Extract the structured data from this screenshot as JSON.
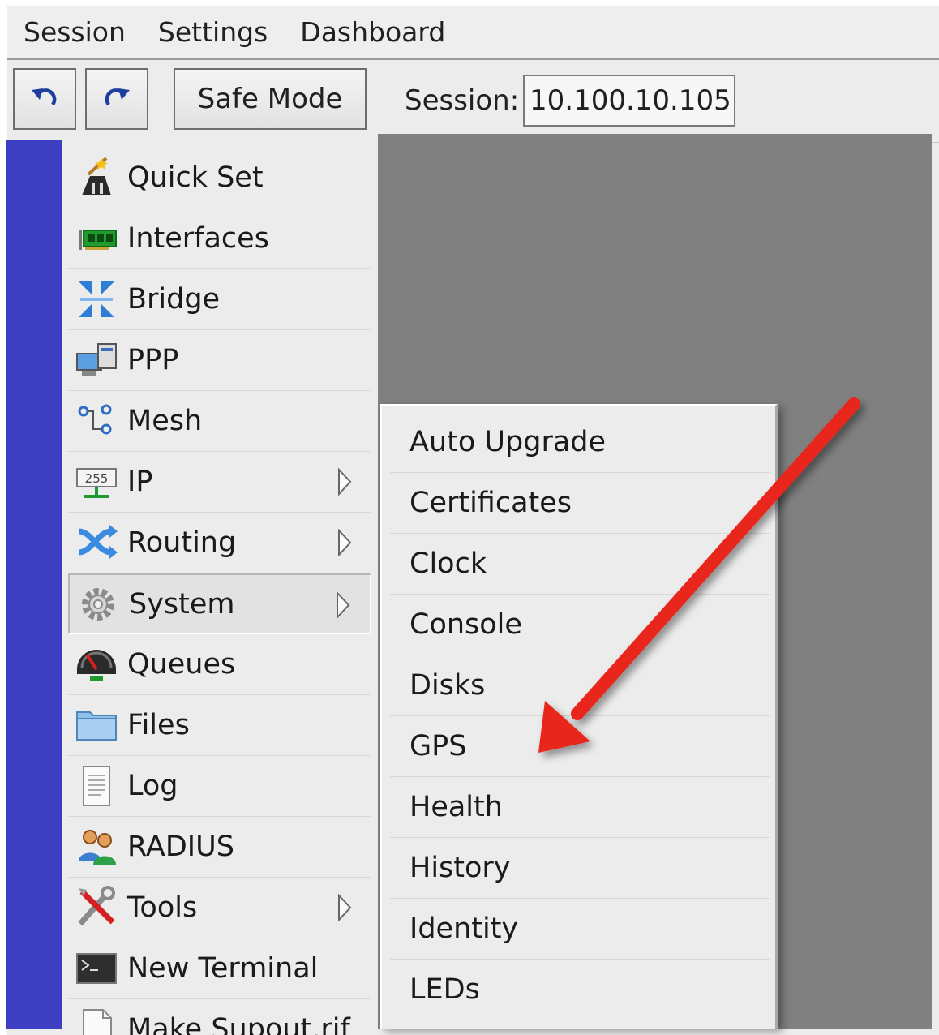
{
  "menubar": {
    "items": [
      "Session",
      "Settings",
      "Dashboard"
    ]
  },
  "toolbar": {
    "undo_icon": "undo-icon",
    "redo_icon": "redo-icon",
    "safe_mode_label": "Safe Mode",
    "session_label": "Session:",
    "session_value": "10.100.10.105"
  },
  "sidebar": {
    "items": [
      {
        "label": "Quick Set",
        "icon": "wand-icon",
        "submenu": false
      },
      {
        "label": "Interfaces",
        "icon": "network-card-icon",
        "submenu": false
      },
      {
        "label": "Bridge",
        "icon": "bridge-icon",
        "submenu": false
      },
      {
        "label": "PPP",
        "icon": "ppp-icon",
        "submenu": false
      },
      {
        "label": "Mesh",
        "icon": "mesh-icon",
        "submenu": false
      },
      {
        "label": "IP",
        "icon": "ip-icon",
        "submenu": true
      },
      {
        "label": "Routing",
        "icon": "routing-icon",
        "submenu": true
      },
      {
        "label": "System",
        "icon": "gear-icon",
        "submenu": true,
        "selected": true
      },
      {
        "label": "Queues",
        "icon": "gauge-icon",
        "submenu": false
      },
      {
        "label": "Files",
        "icon": "folder-icon",
        "submenu": false
      },
      {
        "label": "Log",
        "icon": "document-icon",
        "submenu": false
      },
      {
        "label": "RADIUS",
        "icon": "users-icon",
        "submenu": false
      },
      {
        "label": "Tools",
        "icon": "tools-icon",
        "submenu": true
      },
      {
        "label": "New Terminal",
        "icon": "terminal-icon",
        "submenu": false
      },
      {
        "label": "Make Supout.rif",
        "icon": "file-icon",
        "submenu": false
      }
    ]
  },
  "system_submenu": {
    "items": [
      "Auto Upgrade",
      "Certificates",
      "Clock",
      "Console",
      "Disks",
      "GPS",
      "Health",
      "History",
      "Identity",
      "LEDs"
    ]
  },
  "colors": {
    "stripe": "#3d3fc2",
    "workarea": "#808080",
    "annotation_arrow": "#e8281c"
  }
}
